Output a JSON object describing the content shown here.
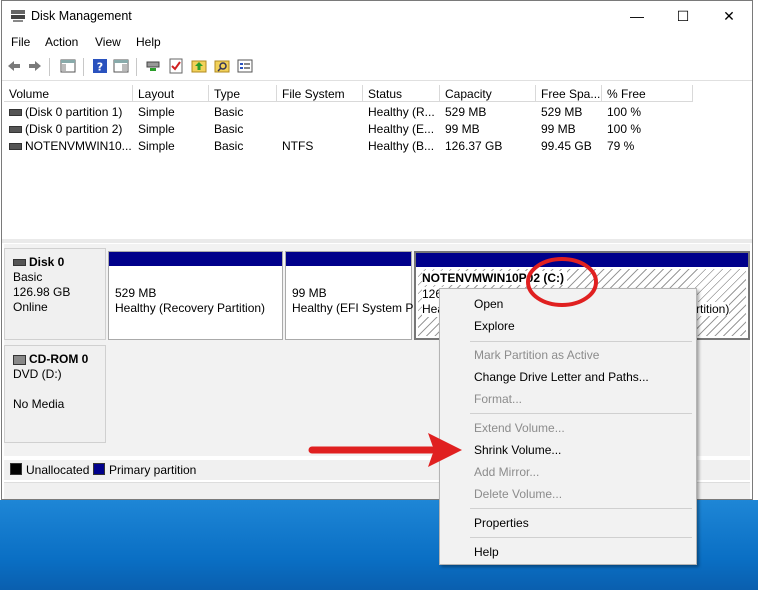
{
  "window": {
    "title": "Disk Management",
    "minimize_glyph": "—",
    "maximize_glyph": "☐",
    "close_glyph": "✕"
  },
  "menu": [
    "File",
    "Action",
    "View",
    "Help"
  ],
  "toolbar_icons": [
    "back-icon",
    "forward-icon",
    "console-tree-icon",
    "help-icon",
    "action-pane-icon",
    "connect-icon",
    "checklist-icon",
    "new-volume-icon",
    "search-icon",
    "properties-icon"
  ],
  "columns": [
    "Volume",
    "Layout",
    "Type",
    "File System",
    "Status",
    "Capacity",
    "Free Spa...",
    "% Free"
  ],
  "volumes": [
    [
      "(Disk 0 partition 1)",
      "Simple",
      "Basic",
      "",
      "Healthy (R...",
      "529 MB",
      "529 MB",
      "100 %"
    ],
    [
      "(Disk 0 partition 2)",
      "Simple",
      "Basic",
      "",
      "Healthy (E...",
      "99 MB",
      "99 MB",
      "100 %"
    ],
    [
      "NOTENVMWIN10...",
      "Simple",
      "Basic",
      "NTFS",
      "Healthy (B...",
      "126.37 GB",
      "99.45 GB",
      "79 %"
    ]
  ],
  "disk0": {
    "name": "Disk 0",
    "type": "Basic",
    "size": "126.98 GB",
    "state": "Online"
  },
  "cdrom": {
    "name": "CD-ROM 0",
    "drive": "DVD (D:)",
    "media": "No Media"
  },
  "partitions": [
    {
      "size": "529 MB",
      "status": "Healthy (Recovery Partition)"
    },
    {
      "size": "99 MB",
      "status": "Healthy (EFI System P"
    },
    {
      "name": "NOTENVMWIN10P02",
      "letter": "(C:)",
      "size": "126",
      "status": "Hea",
      "status_tail": "rtition)"
    }
  ],
  "legend": [
    {
      "label": "Unallocated",
      "color": "#000000"
    },
    {
      "label": "Primary partition",
      "color": "#00008b"
    }
  ],
  "context_menu": [
    {
      "label": "Open",
      "enabled": true
    },
    {
      "label": "Explore",
      "enabled": true
    },
    {
      "sep": true
    },
    {
      "label": "Mark Partition as Active",
      "enabled": false
    },
    {
      "label": "Change Drive Letter and Paths...",
      "enabled": true
    },
    {
      "label": "Format...",
      "enabled": false
    },
    {
      "sep": true
    },
    {
      "label": "Extend Volume...",
      "enabled": false
    },
    {
      "label": "Shrink Volume...",
      "enabled": true
    },
    {
      "label": "Add Mirror...",
      "enabled": false
    },
    {
      "label": "Delete Volume...",
      "enabled": false
    },
    {
      "sep": true
    },
    {
      "label": "Properties",
      "enabled": true
    },
    {
      "sep": true
    },
    {
      "label": "Help",
      "enabled": true
    }
  ],
  "annotation_color": "#e02020"
}
